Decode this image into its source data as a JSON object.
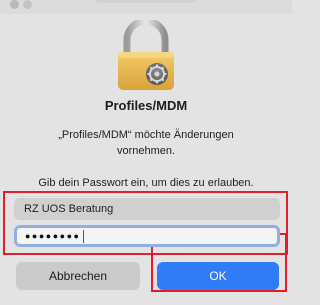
{
  "dialog": {
    "title": "Profiles/MDM",
    "message": "„Profiles/MDM“ möchte Änderungen vornehmen.",
    "instruction": "Gib dein Passwort ein, um dies zu erlauben.",
    "username_value": "RZ UOS Beratung",
    "password_mask": "●●●●●●●●",
    "cancel_label": "Abbrechen",
    "ok_label": "OK",
    "icons": [
      "lock-icon",
      "gear-icon"
    ]
  },
  "colors": {
    "accent": "#2f7cf6",
    "highlight": "#e01e2f"
  }
}
